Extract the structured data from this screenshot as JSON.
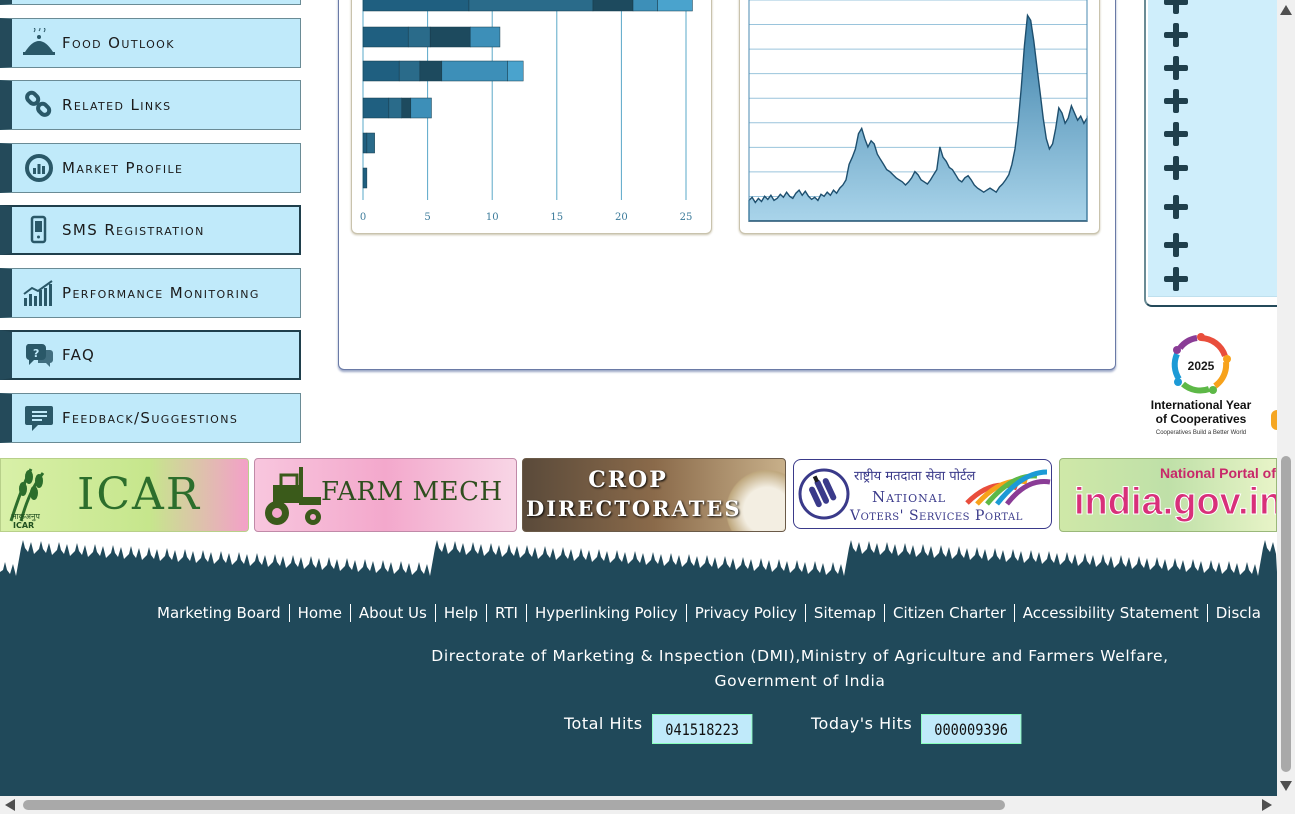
{
  "sidebar": {
    "items": [
      {
        "label": "Food Outlook",
        "icon": "food-cloche-icon"
      },
      {
        "label": "Related Links",
        "icon": "chain-link-icon"
      },
      {
        "label": "Market Profile",
        "icon": "gauge-icon"
      },
      {
        "label": "SMS Registration",
        "icon": "mobile-phone-icon"
      },
      {
        "label": "Performance Monitoring",
        "icon": "bar-trend-icon"
      },
      {
        "label": "FAQ",
        "icon": "question-bubble-icon"
      },
      {
        "label": "Feedback/Suggestions",
        "icon": "speech-bubble-icon"
      }
    ]
  },
  "chart_data": [
    {
      "type": "bar",
      "orientation": "horizontal",
      "stacked": true,
      "x_ticks": [
        0,
        5,
        10,
        15,
        20,
        25
      ],
      "xlim": [
        0,
        26
      ],
      "rows": [
        [
          8.2,
          9.6,
          3.1,
          1.9,
          2.7
        ],
        [
          3.5,
          1.7,
          3.1,
          2.3
        ],
        [
          2.8,
          1.6,
          1.7,
          5.1,
          1.2
        ],
        [
          2.0,
          1.0,
          0.7,
          1.6
        ],
        [
          0.3,
          0.6
        ],
        [
          0.3
        ]
      ],
      "colors": [
        "#1f5f80",
        "#2a6b8a",
        "#1d4a5e",
        "#3d8fb8",
        "#4aa3cd"
      ]
    },
    {
      "type": "area",
      "y_grid_lines": 9,
      "values": [
        20,
        23,
        18,
        22,
        19,
        24,
        21,
        25,
        20,
        22,
        26,
        23,
        28,
        24,
        22,
        27,
        30,
        25,
        29,
        24,
        21,
        23,
        20,
        26,
        24,
        28,
        25,
        30,
        27,
        32,
        35,
        40,
        55,
        62,
        70,
        85,
        90,
        80,
        72,
        78,
        75,
        65,
        60,
        55,
        50,
        48,
        45,
        42,
        40,
        38,
        35,
        38,
        42,
        48,
        45,
        40,
        38,
        36,
        40,
        45,
        50,
        72,
        62,
        58,
        52,
        50,
        45,
        40,
        38,
        42,
        44,
        40,
        35,
        32,
        30,
        28,
        30,
        32,
        30,
        28,
        33,
        36,
        40,
        45,
        55,
        70,
        95,
        130,
        170,
        200,
        195,
        175,
        150,
        125,
        100,
        80,
        70,
        75,
        90,
        110,
        105,
        95,
        100,
        112,
        105,
        98,
        102,
        95,
        100
      ],
      "ymax": 210
    }
  ],
  "right_panel": {
    "plus_rows": 9
  },
  "iyc": {
    "year": "2025",
    "title_line1": "International Year",
    "title_line2": "of Cooperatives",
    "tagline": "Cooperatives Build a Better World"
  },
  "banners": {
    "icar": {
      "text": "ICAR",
      "sub1": "भाकृअनुप",
      "sub2": "ICAR"
    },
    "farm": {
      "text": "FARM MECH"
    },
    "crop": {
      "line1": "CROP",
      "line2": "DIRECTORATES"
    },
    "nvsp": {
      "hindi": "राष्ट्रीय मतदाता सेवा पोर्टल",
      "line1": "National",
      "line2": "Voters' Services Portal"
    },
    "india": {
      "text1": "National Portal of I",
      "text2": "india.gov.in"
    }
  },
  "footer": {
    "links": [
      "Marketing Board",
      "Home",
      "About Us",
      "Help",
      "RTI",
      "Hyperlinking Policy",
      "Privacy Policy",
      "Sitemap",
      "Citizen Charter",
      "Accessibility Statement",
      "Discla"
    ],
    "line1": "Directorate of Marketing & Inspection (DMI),Ministry of Agriculture and Farmers Welfare,",
    "line2": "Government of India",
    "total_hits_label": "Total Hits",
    "total_hits_value": "041518223",
    "todays_hits_label": "Today's Hits",
    "todays_hits_value": "000009396"
  },
  "colors": {
    "footer_bg": "#20495a",
    "sidebar_bg": "#c0eafa",
    "accent": "#244a5a"
  }
}
